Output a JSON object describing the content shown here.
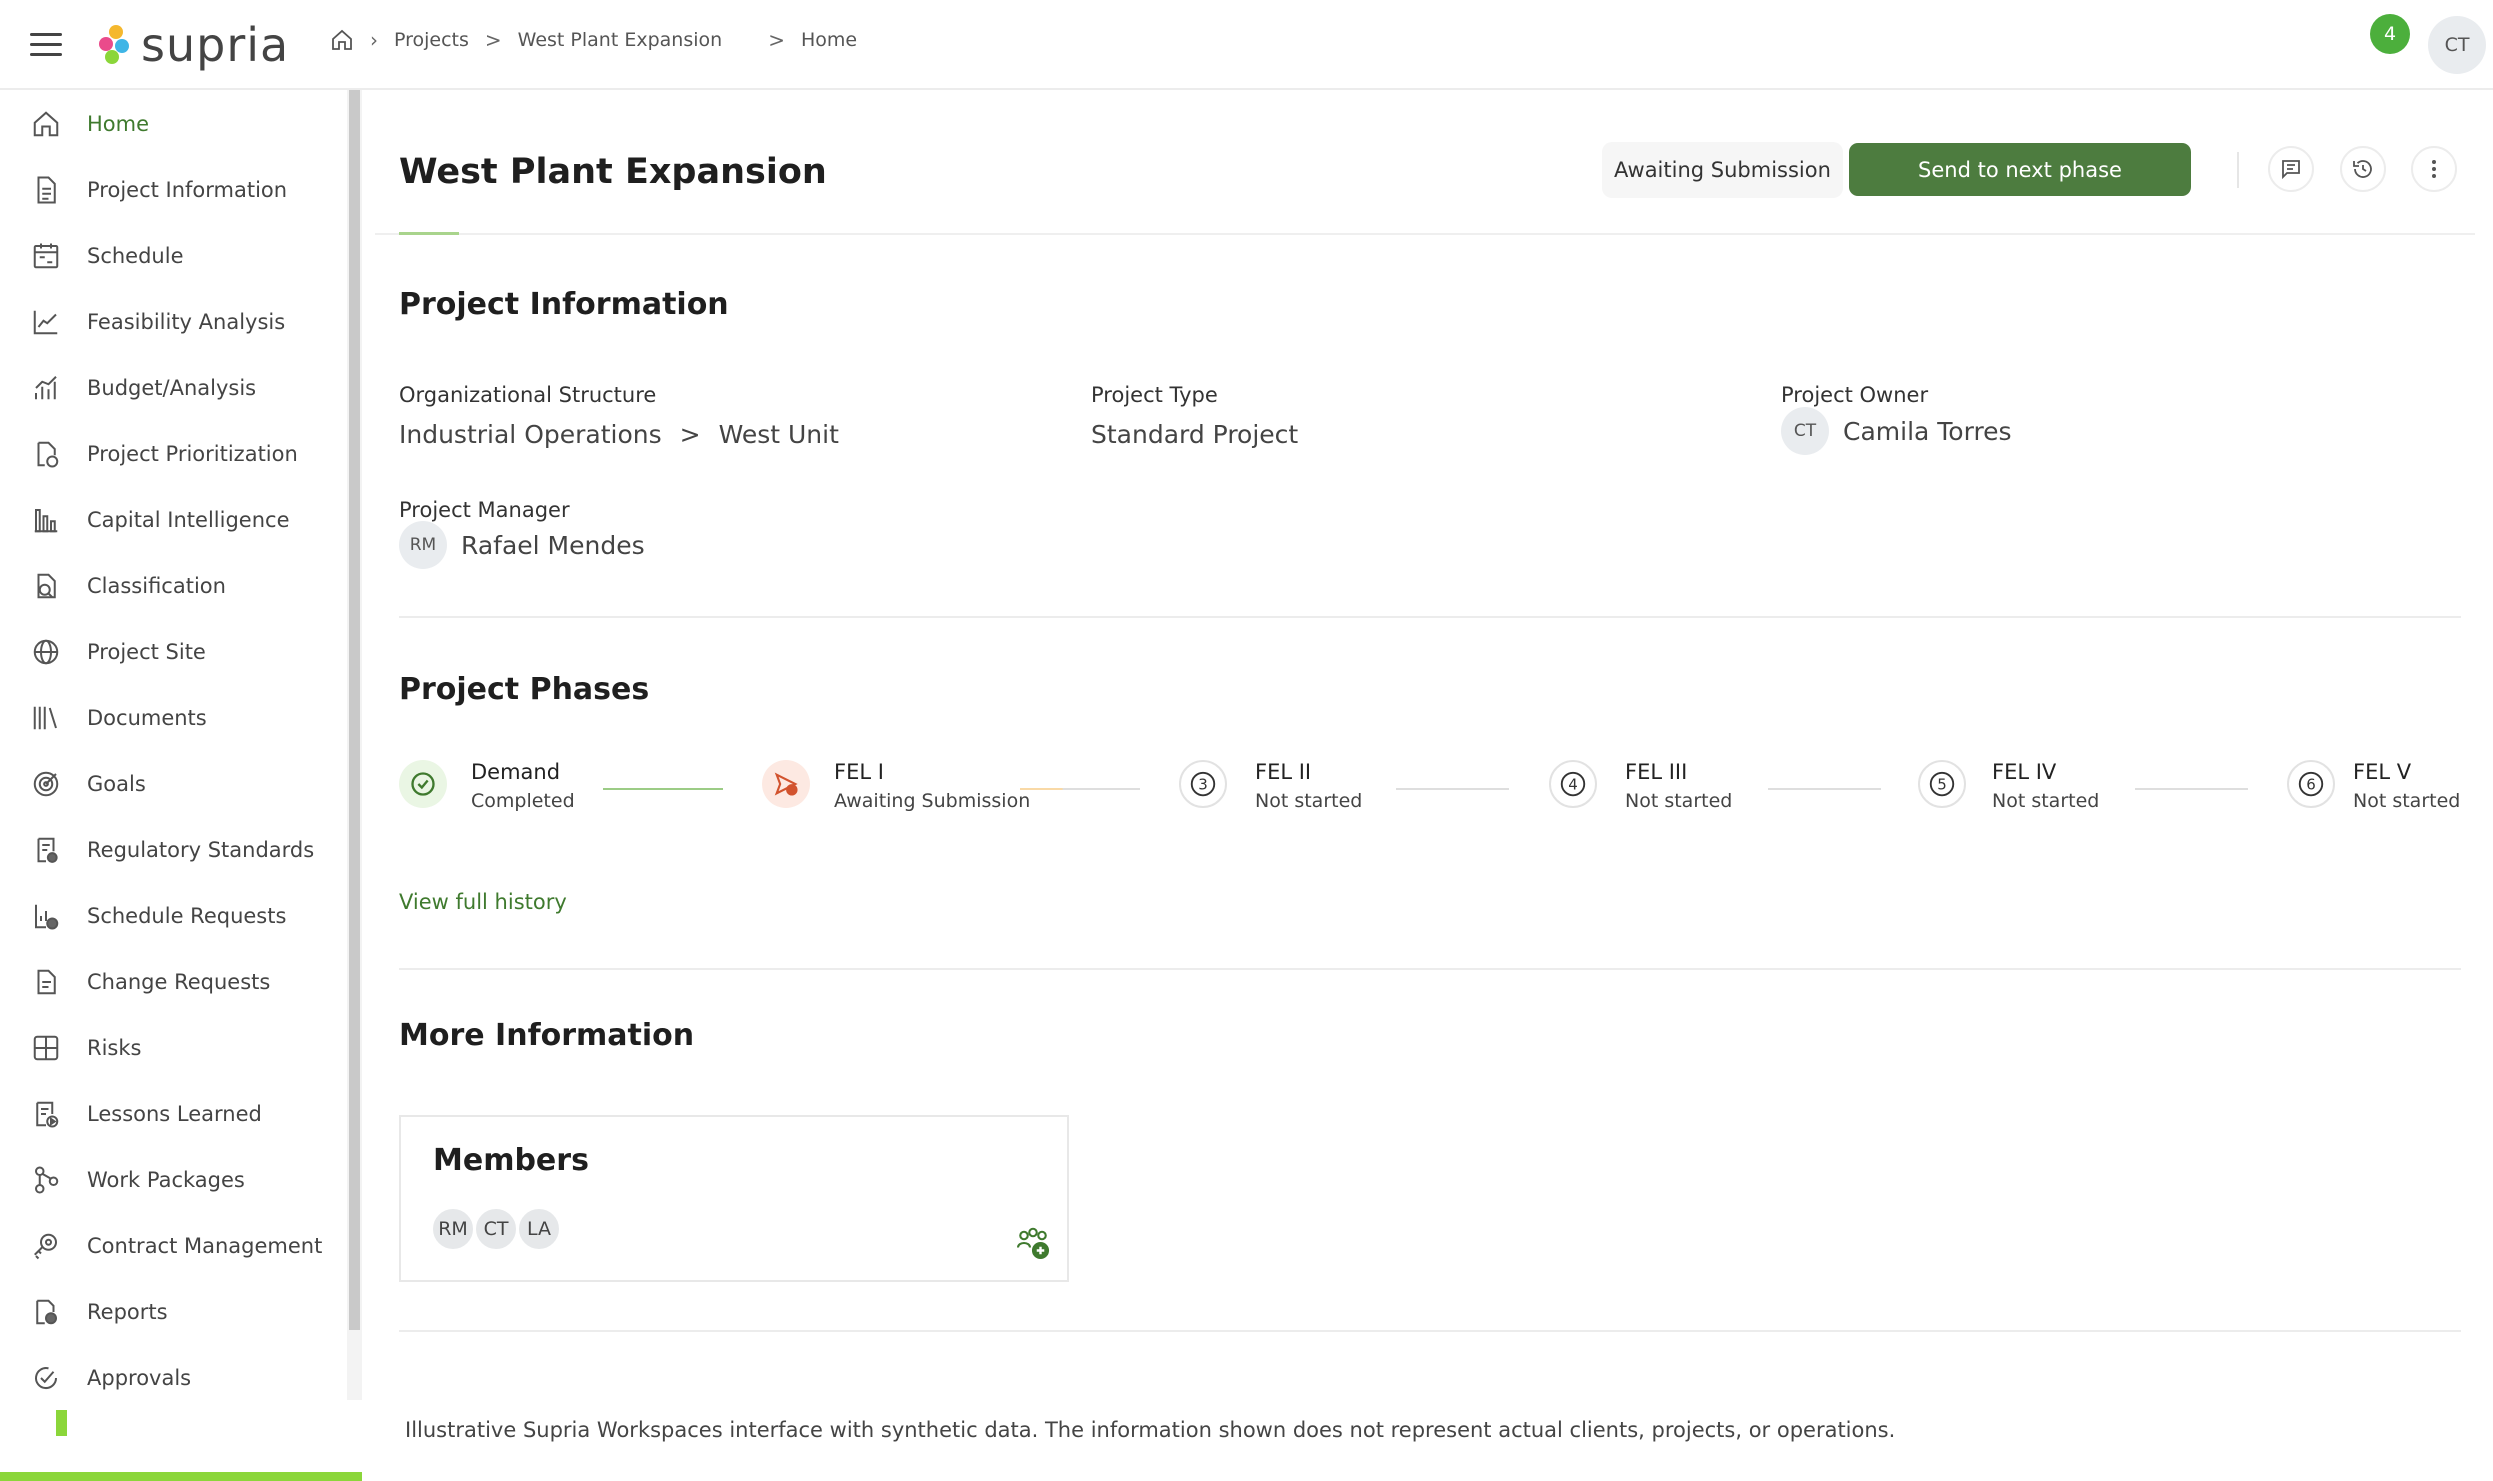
{
  "app": {
    "logo_text": "supria",
    "notification_count": "4",
    "user_initials": "CT"
  },
  "breadcrumb": {
    "projects": "Projects",
    "project": "West Plant Expansion",
    "current": "Home",
    "sep": ">"
  },
  "sidebar": {
    "items": [
      {
        "label": "Home",
        "icon": "home-icon"
      },
      {
        "label": "Project Information",
        "icon": "document-icon"
      },
      {
        "label": "Schedule",
        "icon": "calendar-icon"
      },
      {
        "label": "Feasibility Analysis",
        "icon": "line-chart-icon"
      },
      {
        "label": "Budget/Analysis",
        "icon": "bar-chart-icon"
      },
      {
        "label": "Project Prioritization",
        "icon": "pie-chart-icon"
      },
      {
        "label": "Capital Intelligence",
        "icon": "columns-icon"
      },
      {
        "label": "Classification",
        "icon": "classification-icon"
      },
      {
        "label": "Project Site",
        "icon": "globe-icon"
      },
      {
        "label": "Documents",
        "icon": "library-icon"
      },
      {
        "label": "Goals",
        "icon": "target-icon"
      },
      {
        "label": "Regulatory Standards",
        "icon": "regulation-icon"
      },
      {
        "label": "Schedule Requests",
        "icon": "schedule-request-icon"
      },
      {
        "label": "Change Requests",
        "icon": "change-request-icon"
      },
      {
        "label": "Risks",
        "icon": "risk-icon"
      },
      {
        "label": "Lessons Learned",
        "icon": "lessons-icon"
      },
      {
        "label": "Work Packages",
        "icon": "work-package-icon"
      },
      {
        "label": "Contract Management",
        "icon": "contract-icon"
      },
      {
        "label": "Reports",
        "icon": "report-icon"
      },
      {
        "label": "Approvals",
        "icon": "approval-icon"
      }
    ]
  },
  "header": {
    "title": "West Plant Expansion",
    "status": "Awaiting Submission",
    "send_button": "Send to next phase"
  },
  "project_info": {
    "title": "Project Information",
    "org_label": "Organizational Structure",
    "org_value_1": "Industrial Operations",
    "org_sep": ">",
    "org_value_2": "West Unit",
    "type_label": "Project Type",
    "type_value": "Standard Project",
    "owner_label": "Project Owner",
    "owner_initials": "CT",
    "owner_name": "Camila Torres",
    "manager_label": "Project Manager",
    "manager_initials": "RM",
    "manager_name": "Rafael Mendes"
  },
  "phases": {
    "title": "Project Phases",
    "items": [
      {
        "name": "Demand",
        "status": "Completed"
      },
      {
        "name": "FEL I",
        "status": "Awaiting Submission"
      },
      {
        "name": "FEL II",
        "status": "Not started",
        "num": "3"
      },
      {
        "name": "FEL III",
        "status": "Not started",
        "num": "4"
      },
      {
        "name": "FEL IV",
        "status": "Not started",
        "num": "5"
      },
      {
        "name": "FEL V",
        "status": "Not started",
        "num": "6"
      }
    ],
    "history_link": "View full history"
  },
  "more_info": {
    "title": "More Information",
    "members_title": "Members",
    "members": [
      "RM",
      "CT",
      "LA"
    ]
  },
  "footer": {
    "note": "Illustrative Supria Workspaces interface with synthetic data. The information shown does not represent actual clients, projects, or operations."
  },
  "colors": {
    "accent": "#4d7c3f",
    "accent_text": "#3f7a2e",
    "highlight": "#8bd63a",
    "badge": "#4caf3c"
  }
}
